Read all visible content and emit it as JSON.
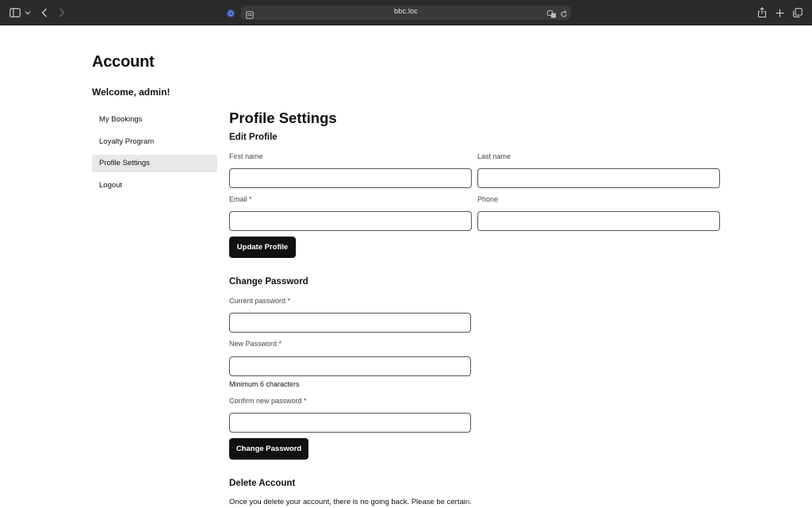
{
  "browser": {
    "url": "bbc.loc",
    "icons": [
      "sidebar-icon",
      "chevron-down-icon",
      "back-icon",
      "forward-icon",
      "shield-icon",
      "reader-icon",
      "translate-icon",
      "reload-icon",
      "share-icon",
      "new-tab-icon",
      "tabs-overview-icon"
    ]
  },
  "page": {
    "title": "Account",
    "welcome": "Welcome, admin!"
  },
  "sidebar": {
    "items": [
      {
        "label": "My Bookings"
      },
      {
        "label": "Loyalty Program"
      },
      {
        "label": "Profile Settings"
      },
      {
        "label": "Logout"
      }
    ],
    "active_item": "Profile Settings"
  },
  "profile": {
    "heading": "Profile Settings",
    "edit_heading": "Edit Profile",
    "first_name_label": "First name",
    "first_name_value": "",
    "last_name_label": "Last name",
    "last_name_value": "",
    "email_label": "Email *",
    "email_value": "",
    "phone_label": "Phone",
    "phone_value": "",
    "update_button": "Update Profile"
  },
  "password": {
    "heading": "Change Password",
    "current_label": "Current password *",
    "new_label": "New Password *",
    "hint": "Minimum 6 characters",
    "confirm_label": "Confirm new password *",
    "change_button": "Change Password"
  },
  "delete": {
    "heading": "Delete Account",
    "warning": "Once you delete your account, there is no going back. Please be certain."
  },
  "colors": {
    "toolbar_bg": "#2b2b2b",
    "button_bg": "#111111",
    "active_nav_bg": "#e8e8e8"
  }
}
